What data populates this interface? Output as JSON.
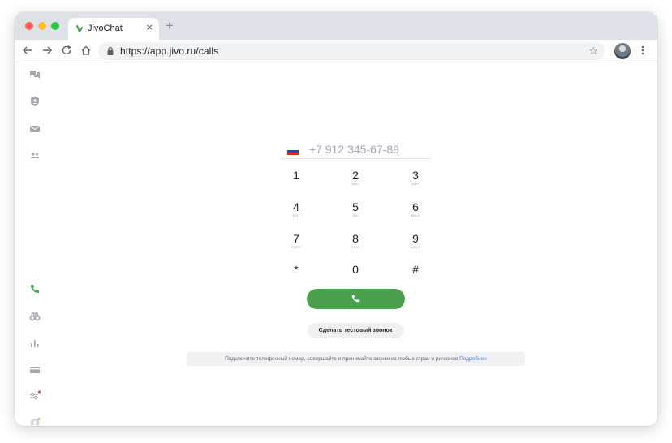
{
  "browser": {
    "tab_title": "JivoChat",
    "tab_close": "×",
    "new_tab": "+",
    "url": "https://app.jivo.ru/calls",
    "bookmark_icon": "star-icon",
    "brand_color": "#4aa04c"
  },
  "sidebar": {
    "items": [
      {
        "name": "chats",
        "icon": "chat-bubbles-icon"
      },
      {
        "name": "visitors",
        "icon": "shield-user-icon"
      },
      {
        "name": "mail",
        "icon": "envelope-icon"
      },
      {
        "name": "team",
        "icon": "people-icon"
      },
      {
        "name": "calls",
        "icon": "phone-icon",
        "active": true
      },
      {
        "name": "monitoring",
        "icon": "binoculars-icon"
      },
      {
        "name": "analytics",
        "icon": "bar-chart-icon"
      },
      {
        "name": "billing",
        "icon": "card-icon"
      },
      {
        "name": "settings",
        "icon": "sliders-icon"
      },
      {
        "name": "profile",
        "icon": "avatar-icon"
      }
    ]
  },
  "dialer": {
    "phone_placeholder": "+7 912 345-67-89",
    "flag": "ru-flag-icon",
    "keys": [
      {
        "digit": "1",
        "letters": ""
      },
      {
        "digit": "2",
        "letters": "ABC"
      },
      {
        "digit": "3",
        "letters": "DEF"
      },
      {
        "digit": "4",
        "letters": "GHI"
      },
      {
        "digit": "5",
        "letters": "JKL"
      },
      {
        "digit": "6",
        "letters": "MNO"
      },
      {
        "digit": "7",
        "letters": "PQRS"
      },
      {
        "digit": "8",
        "letters": "TUV"
      },
      {
        "digit": "9",
        "letters": "WXYZ"
      },
      {
        "digit": "*",
        "letters": ""
      },
      {
        "digit": "0",
        "letters": ""
      },
      {
        "digit": "#",
        "letters": ""
      }
    ],
    "test_call_label": "Сделать тестовый звонок",
    "info_text": "Подключите телефонный номер, совершайте и принимайте звонки из любых стран и регионов",
    "info_link": "Подробнее"
  }
}
